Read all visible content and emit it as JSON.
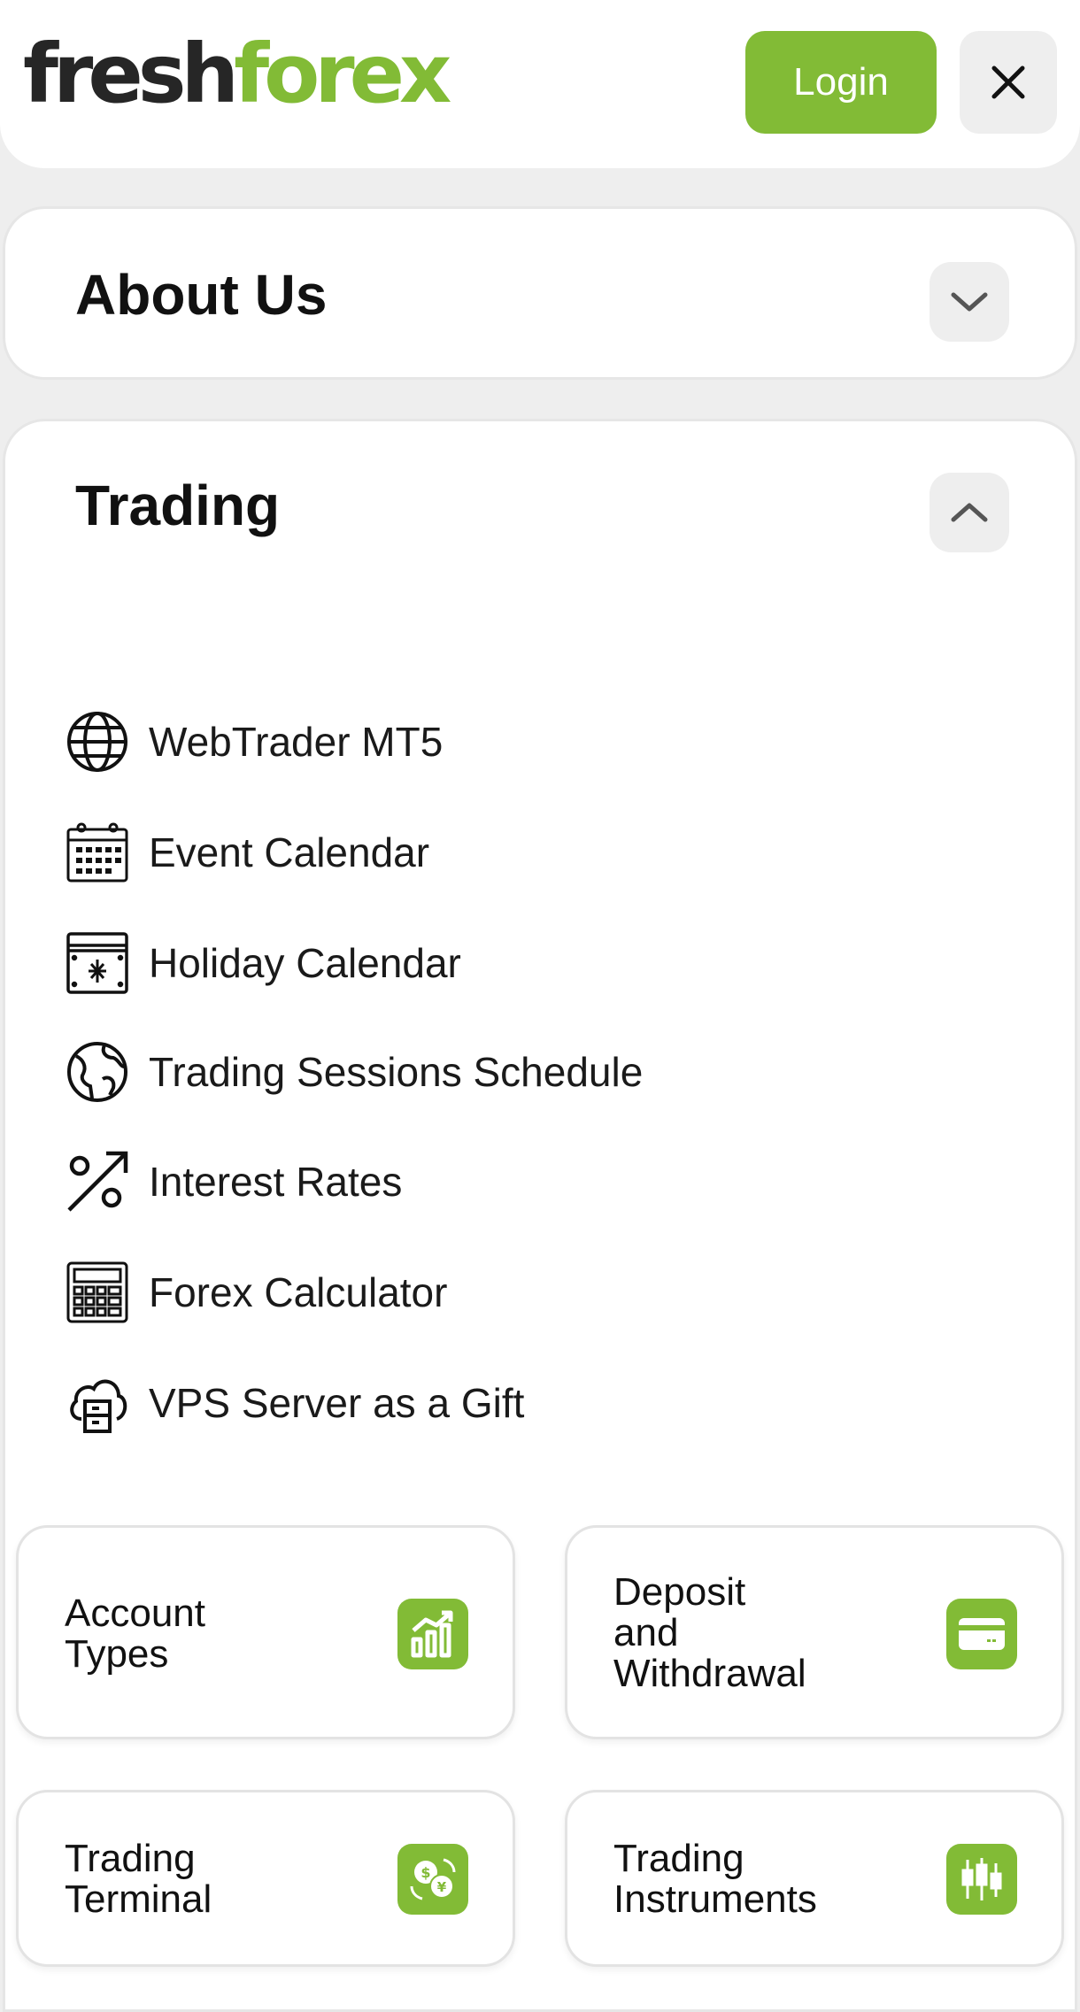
{
  "header": {
    "logo_part1": "fresh",
    "logo_part2": "forex",
    "login_label": "Login",
    "accent_color": "#82bb36"
  },
  "sections": {
    "about": {
      "title": "About Us",
      "icon": "chevron-down-icon"
    },
    "trading": {
      "title": "Trading",
      "icon": "chevron-up-icon",
      "items": [
        {
          "label": "WebTrader MT5",
          "icon": "globe-icon"
        },
        {
          "label": "Event Calendar",
          "icon": "calendar-icon"
        },
        {
          "label": "Holiday Calendar",
          "icon": "holiday-calendar-icon"
        },
        {
          "label": "Trading Sessions Schedule",
          "icon": "earth-icon"
        },
        {
          "label": "Interest Rates",
          "icon": "percent-arrow-icon"
        },
        {
          "label": "Forex Calculator",
          "icon": "calculator-icon"
        },
        {
          "label": "VPS Server as a Gift",
          "icon": "cloud-server-icon"
        }
      ]
    }
  },
  "tiles": [
    {
      "label": "Account Types",
      "icon": "chart-bars-icon"
    },
    {
      "label": "Deposit and Withdrawal",
      "icon": "card-icon"
    },
    {
      "label": "Trading Terminal",
      "icon": "currency-exchange-icon"
    },
    {
      "label": "Trading Instruments",
      "icon": "candlestick-icon"
    }
  ]
}
